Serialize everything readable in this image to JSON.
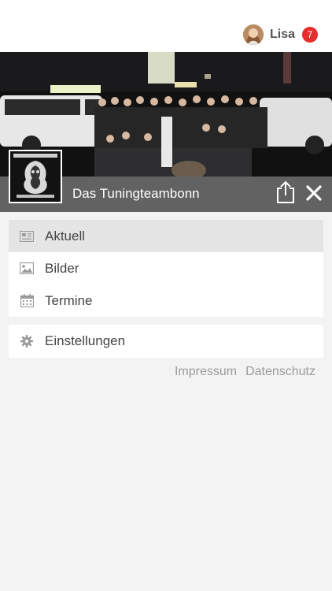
{
  "header": {
    "username": "Lisa",
    "notification_count": "7"
  },
  "group": {
    "name": "Das Tuningteambonn",
    "logo_text": "TUNING TEAMBONN.DE"
  },
  "menu": {
    "items": [
      {
        "label": "Aktuell",
        "icon": "newspaper-icon",
        "active": true
      },
      {
        "label": "Bilder",
        "icon": "image-icon",
        "active": false
      },
      {
        "label": "Termine",
        "icon": "calendar-icon",
        "active": false
      }
    ],
    "settings_label": "Einstellungen"
  },
  "footer": {
    "impressum": "Impressum",
    "datenschutz": "Datenschutz"
  },
  "colors": {
    "badge": "#e52d2d",
    "cover_bar": "#696969",
    "active_row": "#e5e5e5",
    "background": "#f3f3f3"
  }
}
